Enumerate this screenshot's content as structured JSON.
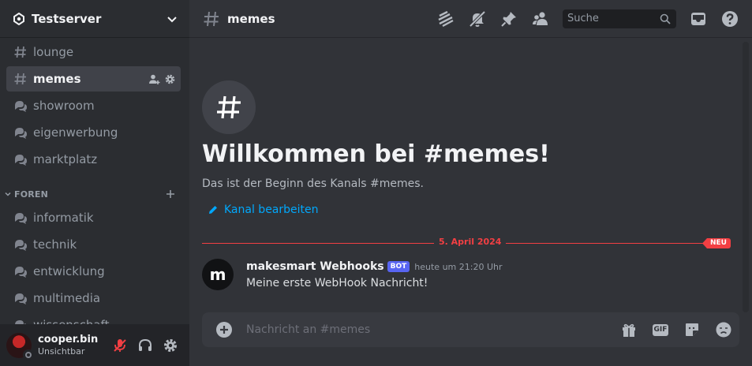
{
  "server": {
    "name": "Testserver"
  },
  "channels": [
    {
      "name": "lounge",
      "icon": "hash-icon"
    },
    {
      "name": "memes",
      "icon": "hash-icon",
      "active": true
    },
    {
      "name": "showroom",
      "icon": "forum-icon"
    },
    {
      "name": "eigenwerbung",
      "icon": "forum-icon"
    },
    {
      "name": "marktplatz",
      "icon": "forum-icon"
    }
  ],
  "category": {
    "name": "FOREN"
  },
  "forum_channels": [
    {
      "name": "informatik",
      "icon": "forum-icon"
    },
    {
      "name": "technik",
      "icon": "forum-icon"
    },
    {
      "name": "entwicklung",
      "icon": "forum-icon"
    },
    {
      "name": "multimedia",
      "icon": "forum-icon"
    },
    {
      "name": "wissenschaft",
      "icon": "forum-icon"
    }
  ],
  "user": {
    "name": "cooper.bin",
    "status": "Unsichtbar"
  },
  "topbar": {
    "channel": "memes",
    "search_placeholder": "Suche"
  },
  "welcome": {
    "title": "Willkommen bei #memes!",
    "subtitle": "Das ist der Beginn des Kanals #memes.",
    "edit_link": "Kanal bearbeiten"
  },
  "divider": {
    "date": "5. April 2024",
    "badge": "NEU"
  },
  "message": {
    "avatar_letter": "m",
    "author": "makesmart Webhooks",
    "tag": "BOT",
    "time": "heute um 21:20 Uhr",
    "text": "Meine erste WebHook Nachricht!"
  },
  "composer": {
    "placeholder": "Nachricht an #memes",
    "gif_label": "GIF"
  },
  "colors": {
    "accent": "#5865f2",
    "link": "#00a8fc",
    "new_marker": "#f23f43"
  }
}
